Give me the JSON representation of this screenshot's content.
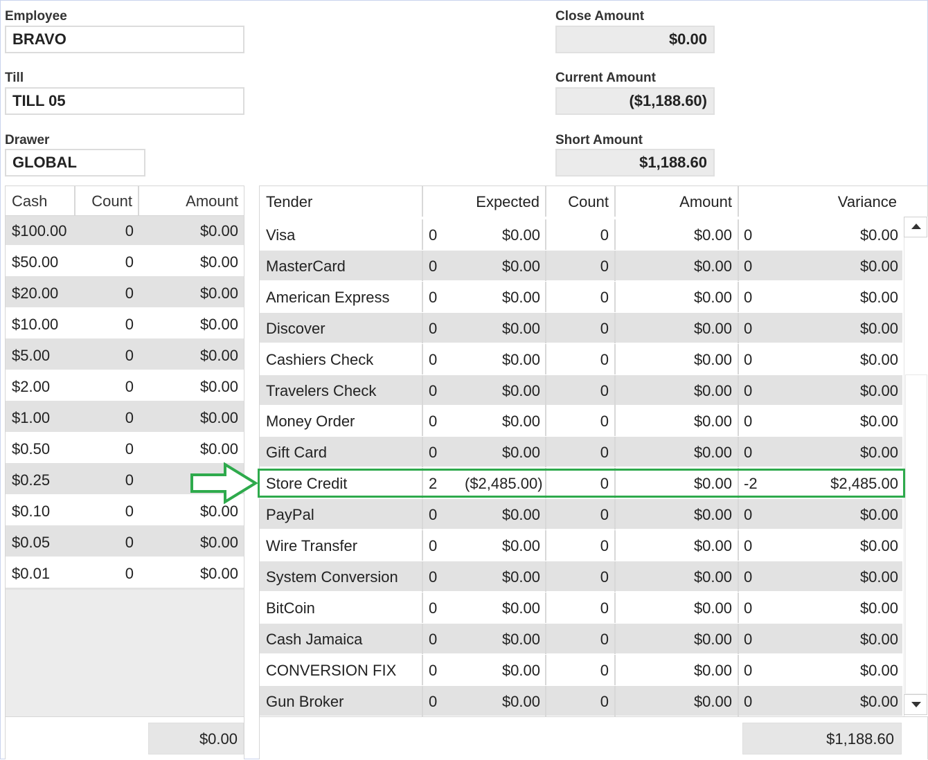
{
  "employee": {
    "label": "Employee",
    "value": "BRAVO"
  },
  "till": {
    "label": "Till",
    "value": "TILL 05"
  },
  "drawer": {
    "label": "Drawer",
    "value": "GLOBAL"
  },
  "close_amount": {
    "label": "Close Amount",
    "value": "$0.00"
  },
  "current_amount": {
    "label": "Current Amount",
    "value": "($1,188.60)"
  },
  "short_amount": {
    "label": "Short Amount",
    "value": "$1,188.60"
  },
  "cash_grid": {
    "headers": {
      "cash": "Cash",
      "count": "Count",
      "amount": "Amount"
    },
    "rows": [
      {
        "cash": "$100.00",
        "count": "0",
        "amount": "$0.00"
      },
      {
        "cash": "$50.00",
        "count": "0",
        "amount": "$0.00"
      },
      {
        "cash": "$20.00",
        "count": "0",
        "amount": "$0.00"
      },
      {
        "cash": "$10.00",
        "count": "0",
        "amount": "$0.00"
      },
      {
        "cash": "$5.00",
        "count": "0",
        "amount": "$0.00"
      },
      {
        "cash": "$2.00",
        "count": "0",
        "amount": "$0.00"
      },
      {
        "cash": "$1.00",
        "count": "0",
        "amount": "$0.00"
      },
      {
        "cash": "$0.50",
        "count": "0",
        "amount": "$0.00"
      },
      {
        "cash": "$0.25",
        "count": "0",
        "amount": ""
      },
      {
        "cash": "$0.10",
        "count": "0",
        "amount": "$0.00"
      },
      {
        "cash": "$0.05",
        "count": "0",
        "amount": "$0.00"
      },
      {
        "cash": "$0.01",
        "count": "0",
        "amount": "$0.00"
      }
    ],
    "total": "$0.00"
  },
  "tender_grid": {
    "headers": {
      "tender": "Tender",
      "expected": "Expected",
      "count": "Count",
      "amount": "Amount",
      "variance": "Variance"
    },
    "rows": [
      {
        "tender": "Visa",
        "exp_count": "0",
        "expected": "$0.00",
        "count": "0",
        "amount": "$0.00",
        "var_count": "0",
        "variance": "$0.00"
      },
      {
        "tender": "MasterCard",
        "exp_count": "0",
        "expected": "$0.00",
        "count": "0",
        "amount": "$0.00",
        "var_count": "0",
        "variance": "$0.00"
      },
      {
        "tender": "American Express",
        "exp_count": "0",
        "expected": "$0.00",
        "count": "0",
        "amount": "$0.00",
        "var_count": "0",
        "variance": "$0.00"
      },
      {
        "tender": "Discover",
        "exp_count": "0",
        "expected": "$0.00",
        "count": "0",
        "amount": "$0.00",
        "var_count": "0",
        "variance": "$0.00"
      },
      {
        "tender": "Cashiers Check",
        "exp_count": "0",
        "expected": "$0.00",
        "count": "0",
        "amount": "$0.00",
        "var_count": "0",
        "variance": "$0.00"
      },
      {
        "tender": "Travelers Check",
        "exp_count": "0",
        "expected": "$0.00",
        "count": "0",
        "amount": "$0.00",
        "var_count": "0",
        "variance": "$0.00"
      },
      {
        "tender": "Money Order",
        "exp_count": "0",
        "expected": "$0.00",
        "count": "0",
        "amount": "$0.00",
        "var_count": "0",
        "variance": "$0.00"
      },
      {
        "tender": "Gift Card",
        "exp_count": "0",
        "expected": "$0.00",
        "count": "0",
        "amount": "$0.00",
        "var_count": "0",
        "variance": "$0.00"
      },
      {
        "tender": "Store Credit",
        "exp_count": "2",
        "expected": "($2,485.00)",
        "count": "0",
        "amount": "$0.00",
        "var_count": "-2",
        "variance": "$2,485.00"
      },
      {
        "tender": "PayPal",
        "exp_count": "0",
        "expected": "$0.00",
        "count": "0",
        "amount": "$0.00",
        "var_count": "0",
        "variance": "$0.00"
      },
      {
        "tender": "Wire Transfer",
        "exp_count": "0",
        "expected": "$0.00",
        "count": "0",
        "amount": "$0.00",
        "var_count": "0",
        "variance": "$0.00"
      },
      {
        "tender": "System Conversion",
        "exp_count": "0",
        "expected": "$0.00",
        "count": "0",
        "amount": "$0.00",
        "var_count": "0",
        "variance": "$0.00"
      },
      {
        "tender": "BitCoin",
        "exp_count": "0",
        "expected": "$0.00",
        "count": "0",
        "amount": "$0.00",
        "var_count": "0",
        "variance": "$0.00"
      },
      {
        "tender": "Cash Jamaica",
        "exp_count": "0",
        "expected": "$0.00",
        "count": "0",
        "amount": "$0.00",
        "var_count": "0",
        "variance": "$0.00"
      },
      {
        "tender": "CONVERSION FIX",
        "exp_count": "0",
        "expected": "$0.00",
        "count": "0",
        "amount": "$0.00",
        "var_count": "0",
        "variance": "$0.00"
      },
      {
        "tender": "Gun Broker",
        "exp_count": "0",
        "expected": "$0.00",
        "count": "0",
        "amount": "$0.00",
        "var_count": "0",
        "variance": "$0.00"
      }
    ],
    "total": "$1,188.60"
  },
  "highlight": {
    "row": "Store Credit",
    "color": "#2eaa4c"
  }
}
